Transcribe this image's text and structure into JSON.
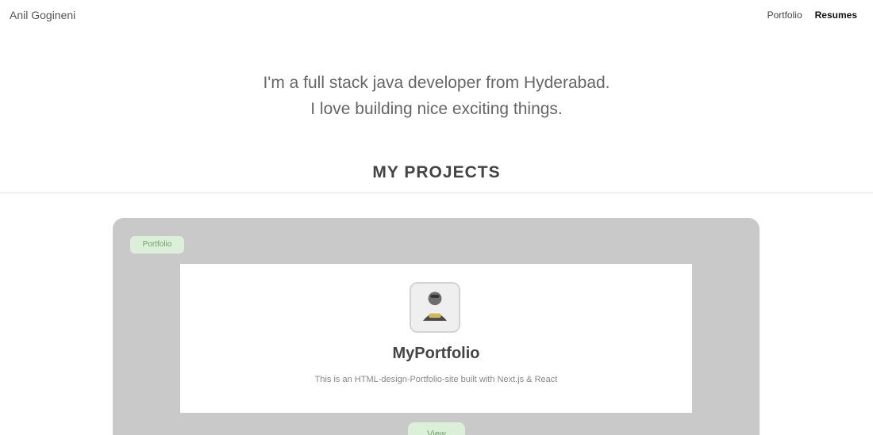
{
  "header": {
    "brand": "Anil Gogineni",
    "nav": [
      {
        "label": "Portfolio",
        "active": false
      },
      {
        "label": "Resumes",
        "active": true
      }
    ]
  },
  "hero": {
    "line1": "I'm a full stack java developer from Hyderabad.",
    "line2": "I love building nice exciting things."
  },
  "projects": {
    "title": "MY PROJECTS",
    "items": [
      {
        "tag": "Portfolio",
        "icon": "avatar-icon",
        "name": "MyPortfolio",
        "description": "This is an HTML-design-Portfolio-site built with Next.js & React",
        "button_label": "View"
      }
    ]
  },
  "colors": {
    "card_bg": "#c9c9c9",
    "tag_bg": "#dcefd9",
    "tag_text": "#6d9e6a"
  }
}
